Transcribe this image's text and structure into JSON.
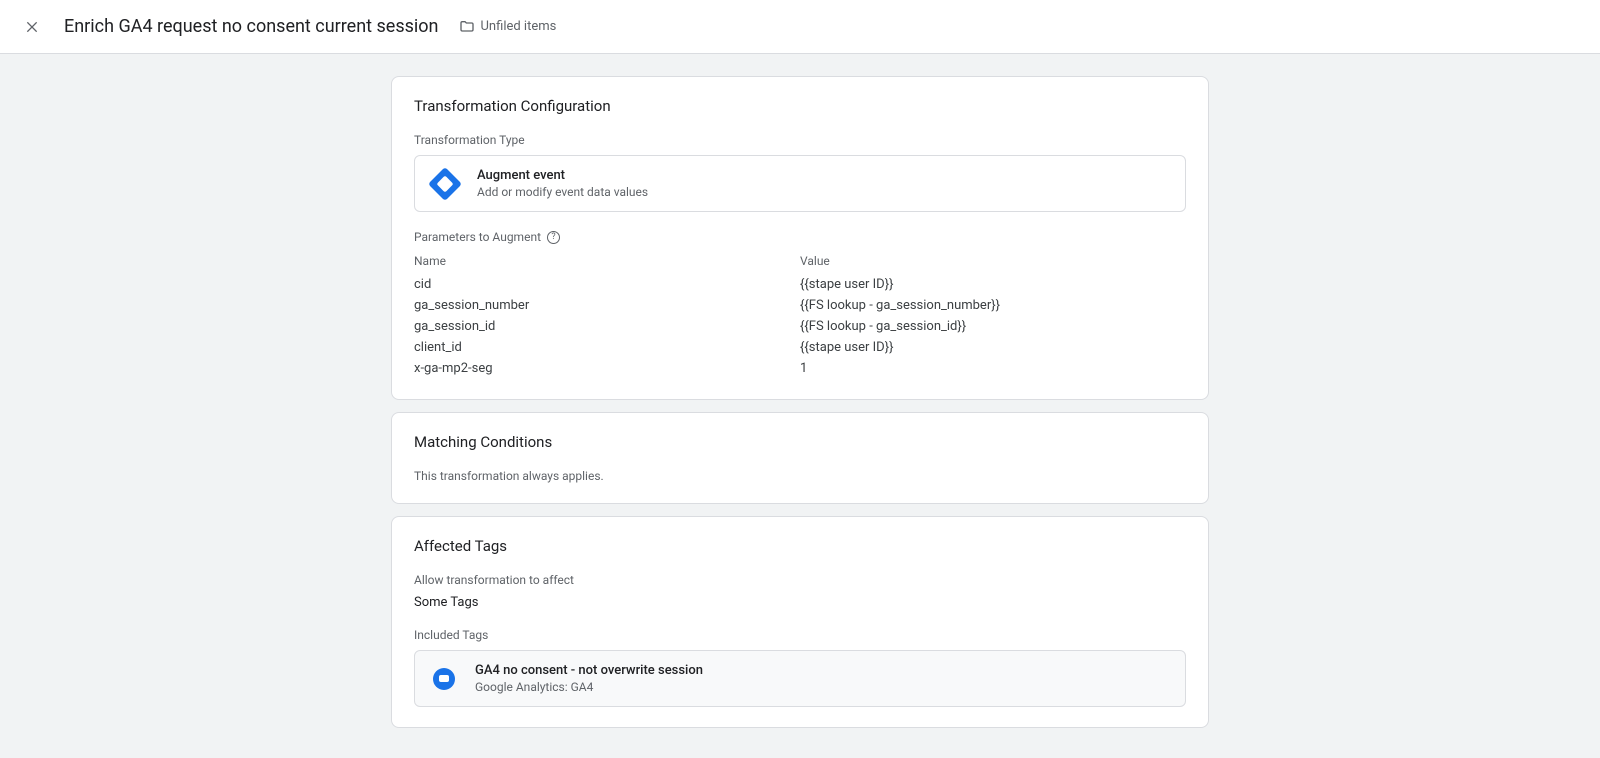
{
  "header": {
    "title": "Enrich GA4 request no consent current session",
    "folder_label": "Unfiled items"
  },
  "transformation": {
    "card_title": "Transformation Configuration",
    "type_label": "Transformation Type",
    "type_name": "Augment event",
    "type_desc": "Add or modify event data values",
    "params_label": "Parameters to Augment",
    "col_name": "Name",
    "col_value": "Value",
    "rows": [
      {
        "name": "cid",
        "value": "{{stape user ID}}"
      },
      {
        "name": "ga_session_number",
        "value": "{{FS lookup - ga_session_number}}"
      },
      {
        "name": "ga_session_id",
        "value": "{{FS lookup - ga_session_id}}"
      },
      {
        "name": "client_id",
        "value": "{{stape user ID}}"
      },
      {
        "name": "x-ga-mp2-seg",
        "value": "1"
      }
    ]
  },
  "matching": {
    "card_title": "Matching Conditions",
    "text": "This transformation always applies."
  },
  "affected": {
    "card_title": "Affected Tags",
    "allow_label": "Allow transformation to affect",
    "allow_value": "Some Tags",
    "included_label": "Included Tags",
    "tag_name": "GA4 no consent - not overwrite session",
    "tag_desc": "Google Analytics: GA4"
  }
}
